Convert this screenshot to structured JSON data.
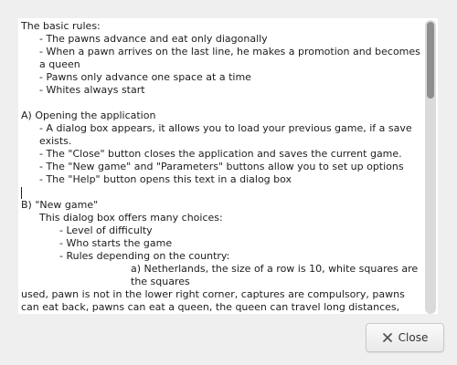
{
  "help_dialog": {
    "lines": [
      {
        "indent": 0,
        "text": "The basic rules:"
      },
      {
        "indent": 1,
        "text": "- The pawns advance and eat only diagonally"
      },
      {
        "indent": 1,
        "text": "- When a pawn arrives on the last line, he makes a promotion and becomes a queen"
      },
      {
        "indent": 1,
        "text": "- Pawns only advance one space at a time"
      },
      {
        "indent": 1,
        "text": "- Whites always start"
      },
      {
        "indent": 0,
        "text": ""
      },
      {
        "indent": 0,
        "text": "A) Opening the application"
      },
      {
        "indent": 1,
        "text": "- A dialog box appears, it allows you to load your previous game, if a save exists."
      },
      {
        "indent": 1,
        "text": "- The \"Close\" button closes the application and saves the current game."
      },
      {
        "indent": 1,
        "text": "- The \"New game\" and \"Parameters\" buttons allow you to set up options"
      },
      {
        "indent": 1,
        "text": "- The \"Help\" button opens this text in a dialog box"
      },
      {
        "indent": 0,
        "text": "",
        "cursor": true
      },
      {
        "indent": 0,
        "text": "B) \"New game\""
      },
      {
        "indent": 1,
        "text": "This dialog box offers many choices:"
      },
      {
        "indent": 2,
        "text": "- Level of difficulty"
      },
      {
        "indent": 2,
        "text": "- Who starts the game"
      },
      {
        "indent": 2,
        "text": "- Rules depending on the country:"
      },
      {
        "indent": 3,
        "text": "a) Netherlands, the size of a row is 10, white squares are the squares",
        "hang": true
      },
      {
        "indent": 0,
        "text": "used, pawn is not in the lower right corner, captures are compulsory, pawns can eat back, pawns can eat a queen, the queen can travel long distances, pawns cannot promote in a roundup"
      }
    ]
  },
  "buttons": {
    "close_label": "Close"
  },
  "scrollbar": {
    "position": 0.0
  }
}
